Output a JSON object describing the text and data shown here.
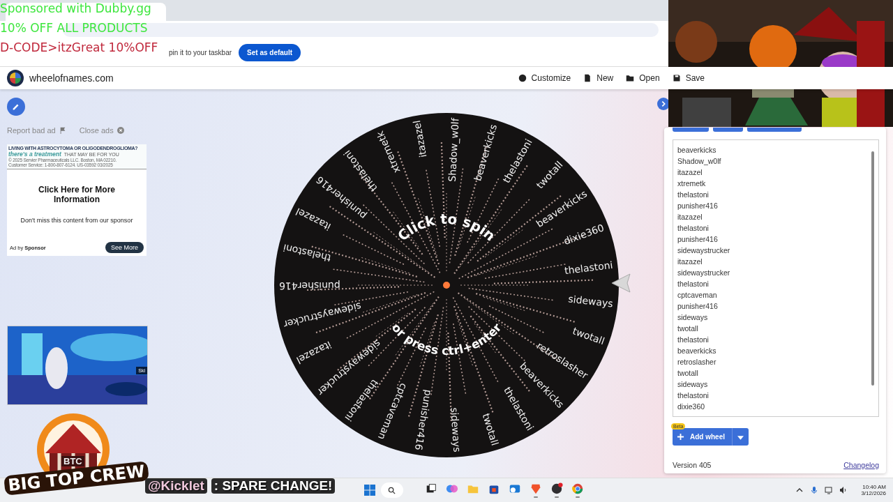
{
  "browser": {
    "infobar_text": "pin it to your taskbar",
    "infobar_button": "Set as default"
  },
  "app_header": {
    "site": "wheelofnames.com",
    "actions": [
      {
        "label": "Customize",
        "kind": "palette"
      },
      {
        "label": "New",
        "kind": "file"
      },
      {
        "label": "Open",
        "kind": "folder"
      },
      {
        "label": "Save",
        "kind": "save"
      }
    ]
  },
  "ads": {
    "report": "Report bad ad",
    "close": "Close ads",
    "banner_line_1": "LIVING WITH ASTROCYTOMA OR OLIGODENDROGLIOMA?",
    "banner_treatment": "there's a treatment",
    "banner_line_2": "THAT MAY BE FOR YOU",
    "banner_legal_1": "© 2025 Servier Pharmaceuticals LLC. Boston, MA 02210.",
    "banner_legal_2": "Customer Service: 1-800-807-6124. US-03592 03/2025",
    "headline": "Click Here for More Information",
    "body": "Don't miss this content from our sponsor",
    "ad_by": "Ad by",
    "sponsor": "Sponsor",
    "cta": "See More",
    "video_skip": "Ski"
  },
  "wheel": {
    "top_text": "Click to spin",
    "bottom_text": "or press ctrl+enter",
    "labels": [
      "Shadow_w0lf",
      "beaverkicks",
      "thelastoni",
      "twotall",
      "beaverkicks",
      "dixie360",
      "thelastoni",
      "sideways",
      "twotall",
      "retroslasher",
      "beaverkicks",
      "thelastoni",
      "twotall",
      "sideways",
      "punisher416",
      "cptcaveman",
      "thelastoni",
      "sidewaystrucker",
      "itazazel",
      "sidewaystrucker",
      "punisher416",
      "thelastoni",
      "itazazel",
      "punisher416",
      "thelastoni",
      "xtremetk",
      "itazazel"
    ]
  },
  "entries": [
    "beaverkicks",
    "Shadow_w0lf",
    "itazazel",
    "xtremetk",
    "thelastoni",
    "punisher416",
    "itazazel",
    "thelastoni",
    "punisher416",
    "sidewaystrucker",
    "itazazel",
    "sidewaystrucker",
    "thelastoni",
    "cptcaveman",
    "punisher416",
    "sideways",
    "twotall",
    "thelastoni",
    "beaverkicks",
    "retroslasher",
    "twotall",
    "sideways",
    "thelastoni",
    "dixie360"
  ],
  "panel_footer": {
    "badge": "Beta",
    "add_wheel": "Add wheel",
    "version": "Version 405",
    "changelog": "Changelog"
  },
  "stream_overlay": {
    "sponsor_lines": [
      {
        "text": "Sponsored with Dubby.gg",
        "color": "#3ee63e"
      },
      {
        "text": "10% OFF ALL PRODUCTS",
        "color": "#3ee63e"
      },
      {
        "text": "D-CODE>itzGreat 10%OFF",
        "color": "#c0283c"
      }
    ],
    "logo_initials": "BTC",
    "logo_name": "BIG TOP CREW",
    "chat_user": "@Kicklet",
    "chat_message": ": SPARE CHANGE!"
  },
  "taskbar": {
    "apps": [
      {
        "kind": "taskview",
        "running": false
      },
      {
        "kind": "copilot",
        "running": false
      },
      {
        "kind": "folder",
        "running": false
      },
      {
        "kind": "store",
        "running": false
      },
      {
        "kind": "mail",
        "running": false
      },
      {
        "kind": "brave",
        "running": true
      },
      {
        "kind": "obs",
        "running": true
      },
      {
        "kind": "chrome",
        "running": true
      }
    ],
    "time": "10:40 AM",
    "date": "3/12/2026"
  }
}
